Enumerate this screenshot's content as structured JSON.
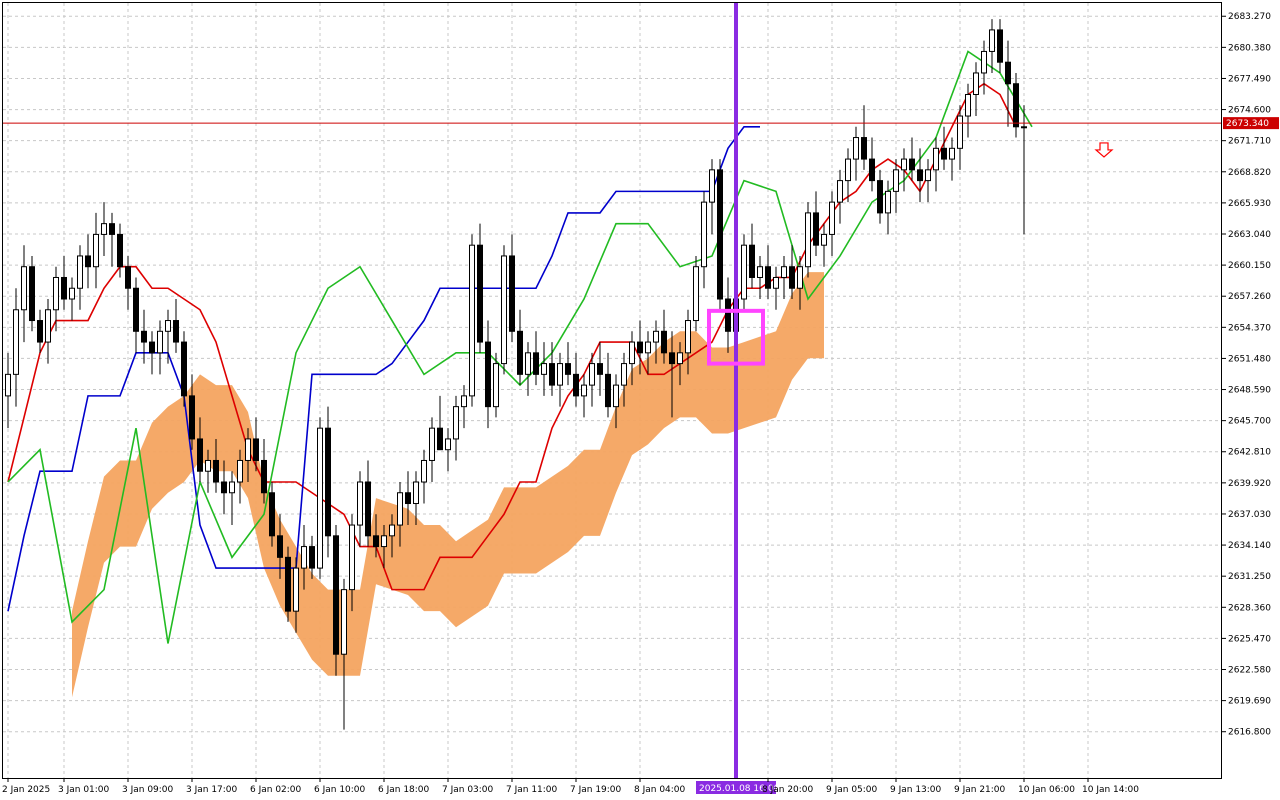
{
  "chart_data": {
    "type": "candlestick",
    "ylim": [
      2612.5,
      2684.5
    ],
    "y_ticks": [
      "2683.270",
      "2680.380",
      "2677.490",
      "2674.600",
      "2671.710",
      "2668.820",
      "2665.930",
      "2663.040",
      "2660.150",
      "2657.260",
      "2654.370",
      "2651.480",
      "2648.590",
      "2645.700",
      "2642.810",
      "2639.920",
      "2637.030",
      "2634.140",
      "2631.250",
      "2628.360",
      "2625.470",
      "2622.580",
      "2619.690",
      "2616.800"
    ],
    "x_ticks": [
      {
        "label": "2 Jan 2025",
        "bar": 0
      },
      {
        "label": "3 Jan 01:00",
        "bar": 7
      },
      {
        "label": "3 Jan 09:00",
        "bar": 15
      },
      {
        "label": "3 Jan 17:00",
        "bar": 23
      },
      {
        "label": "6 Jan 02:00",
        "bar": 31
      },
      {
        "label": "6 Jan 10:00",
        "bar": 39
      },
      {
        "label": "6 Jan 18:00",
        "bar": 47
      },
      {
        "label": "7 Jan 03:00",
        "bar": 55
      },
      {
        "label": "7 Jan 11:00",
        "bar": 63
      },
      {
        "label": "7 Jan 19:00",
        "bar": 71
      },
      {
        "label": "8 Jan 04:00",
        "bar": 79
      },
      {
        "label": "8 Jan 20:00",
        "bar": 95
      },
      {
        "label": "9 Jan 05:00",
        "bar": 103
      },
      {
        "label": "9 Jan 13:00",
        "bar": 111
      },
      {
        "label": "9 Jan 21:00",
        "bar": 119
      },
      {
        "label": "10 Jan 06:00",
        "bar": 127
      },
      {
        "label": "10 Jan 14:00",
        "bar": 135
      }
    ],
    "current_price": {
      "label": "2673.340",
      "value": 2673.34
    },
    "vertical_marker": {
      "label": "2025.01.08 16:00",
      "bar": 91
    },
    "highlight_box": {
      "from_bar": 88,
      "to_bar": 94,
      "y_low": 2651.0,
      "y_high": 2655.9
    },
    "sell_signal": {
      "bar": 137,
      "value": 2671.5
    },
    "candles": [
      [
        2648,
        2652,
        2645,
        2650
      ],
      [
        2650,
        2658,
        2647,
        2656
      ],
      [
        2656,
        2662,
        2653,
        2660
      ],
      [
        2660,
        2661,
        2654,
        2655
      ],
      [
        2655,
        2656,
        2652,
        2653
      ],
      [
        2653,
        2657,
        2651,
        2656
      ],
      [
        2656,
        2660,
        2654,
        2659
      ],
      [
        2659,
        2661,
        2656,
        2657
      ],
      [
        2657,
        2659,
        2655,
        2658
      ],
      [
        2658,
        2662,
        2656,
        2661
      ],
      [
        2661,
        2663,
        2658,
        2660
      ],
      [
        2660,
        2665,
        2658,
        2663
      ],
      [
        2663,
        2666,
        2661,
        2664
      ],
      [
        2664,
        2665,
        2660,
        2663
      ],
      [
        2663,
        2664,
        2659,
        2660
      ],
      [
        2660,
        2661,
        2656,
        2658
      ],
      [
        2658,
        2659,
        2652,
        2654
      ],
      [
        2654,
        2656,
        2651,
        2653
      ],
      [
        2653,
        2654,
        2650,
        2652
      ],
      [
        2652,
        2655,
        2650,
        2654
      ],
      [
        2654,
        2656,
        2651,
        2655
      ],
      [
        2655,
        2657,
        2652,
        2653
      ],
      [
        2653,
        2654,
        2647,
        2648
      ],
      [
        2648,
        2650,
        2643,
        2644
      ],
      [
        2644,
        2646,
        2640,
        2641
      ],
      [
        2641,
        2643,
        2639,
        2642
      ],
      [
        2642,
        2644,
        2639,
        2640
      ],
      [
        2640,
        2642,
        2637,
        2639
      ],
      [
        2639,
        2641,
        2636,
        2640
      ],
      [
        2640,
        2643,
        2638,
        2642
      ],
      [
        2642,
        2645,
        2640,
        2644
      ],
      [
        2644,
        2646,
        2641,
        2642
      ],
      [
        2642,
        2644,
        2638,
        2639
      ],
      [
        2639,
        2640,
        2634,
        2635
      ],
      [
        2635,
        2637,
        2631,
        2633
      ],
      [
        2633,
        2634,
        2627,
        2628
      ],
      [
        2628,
        2633,
        2626,
        2632
      ],
      [
        2632,
        2636,
        2630,
        2634
      ],
      [
        2634,
        2635,
        2631,
        2632
      ],
      [
        2632,
        2646,
        2631,
        2645
      ],
      [
        2645,
        2647,
        2633,
        2635
      ],
      [
        2635,
        2636,
        2622,
        2624
      ],
      [
        2624,
        2631,
        2617,
        2630
      ],
      [
        2630,
        2637,
        2628,
        2636
      ],
      [
        2636,
        2641,
        2634,
        2640
      ],
      [
        2640,
        2642,
        2634,
        2635
      ],
      [
        2635,
        2637,
        2633,
        2634
      ],
      [
        2634,
        2636,
        2632,
        2635
      ],
      [
        2635,
        2637,
        2633,
        2636
      ],
      [
        2636,
        2640,
        2634,
        2639
      ],
      [
        2639,
        2641,
        2636,
        2638
      ],
      [
        2638,
        2641,
        2636,
        2640
      ],
      [
        2640,
        2643,
        2638,
        2642
      ],
      [
        2642,
        2646,
        2640,
        2645
      ],
      [
        2645,
        2648,
        2643,
        2643
      ],
      [
        2643,
        2645,
        2641,
        2644
      ],
      [
        2644,
        2648,
        2642,
        2647
      ],
      [
        2647,
        2649,
        2645,
        2648
      ],
      [
        2648,
        2663,
        2647,
        2662
      ],
      [
        2662,
        2664,
        2652,
        2653
      ],
      [
        2653,
        2655,
        2645,
        2647
      ],
      [
        2647,
        2652,
        2646,
        2651
      ],
      [
        2651,
        2662,
        2650,
        2661
      ],
      [
        2661,
        2663,
        2653,
        2654
      ],
      [
        2654,
        2656,
        2649,
        2650
      ],
      [
        2650,
        2653,
        2648,
        2652
      ],
      [
        2652,
        2654,
        2649,
        2650
      ],
      [
        2650,
        2653,
        2648,
        2651
      ],
      [
        2651,
        2653,
        2648,
        2649
      ],
      [
        2649,
        2652,
        2647,
        2651
      ],
      [
        2651,
        2653,
        2649,
        2650
      ],
      [
        2650,
        2652,
        2647,
        2648
      ],
      [
        2648,
        2650,
        2646,
        2649
      ],
      [
        2649,
        2652,
        2647,
        2651
      ],
      [
        2651,
        2653,
        2648,
        2650
      ],
      [
        2650,
        2652,
        2646,
        2647
      ],
      [
        2647,
        2650,
        2645,
        2649
      ],
      [
        2649,
        2652,
        2647,
        2651
      ],
      [
        2651,
        2654,
        2649,
        2653
      ],
      [
        2653,
        2655,
        2650,
        2652
      ],
      [
        2652,
        2654,
        2650,
        2653
      ],
      [
        2653,
        2655,
        2651,
        2654
      ],
      [
        2654,
        2656,
        2651,
        2652
      ],
      [
        2652,
        2654,
        2646,
        2651
      ],
      [
        2651,
        2653,
        2649,
        2652
      ],
      [
        2652,
        2656,
        2650,
        2655
      ],
      [
        2655,
        2661,
        2654,
        2660
      ],
      [
        2660,
        2667,
        2658,
        2666
      ],
      [
        2666,
        2670,
        2663,
        2669
      ],
      [
        2669,
        2670,
        2656,
        2657
      ],
      [
        2657,
        2659,
        2652,
        2654
      ],
      [
        2654,
        2658,
        2653,
        2657
      ],
      [
        2657,
        2663,
        2656,
        2662
      ],
      [
        2662,
        2664,
        2658,
        2659
      ],
      [
        2659,
        2661,
        2657,
        2660
      ],
      [
        2660,
        2662,
        2657,
        2658
      ],
      [
        2658,
        2660,
        2656,
        2659
      ],
      [
        2659,
        2661,
        2657,
        2660
      ],
      [
        2660,
        2662,
        2657,
        2658
      ],
      [
        2658,
        2661,
        2656,
        2660
      ],
      [
        2660,
        2666,
        2659,
        2665
      ],
      [
        2665,
        2667,
        2661,
        2662
      ],
      [
        2662,
        2664,
        2660,
        2663
      ],
      [
        2663,
        2667,
        2661,
        2666
      ],
      [
        2666,
        2669,
        2664,
        2668
      ],
      [
        2668,
        2671,
        2666,
        2670
      ],
      [
        2670,
        2673,
        2668,
        2672
      ],
      [
        2672,
        2675,
        2669,
        2670
      ],
      [
        2670,
        2672,
        2667,
        2668
      ],
      [
        2668,
        2669,
        2664,
        2665
      ],
      [
        2665,
        2668,
        2663,
        2667
      ],
      [
        2667,
        2670,
        2665,
        2669
      ],
      [
        2669,
        2671,
        2667,
        2670
      ],
      [
        2670,
        2672,
        2668,
        2669
      ],
      [
        2669,
        2671,
        2666,
        2668
      ],
      [
        2668,
        2670,
        2666,
        2669
      ],
      [
        2669,
        2672,
        2667,
        2671
      ],
      [
        2671,
        2673,
        2669,
        2670
      ],
      [
        2670,
        2672,
        2668,
        2671
      ],
      [
        2671,
        2675,
        2669,
        2674
      ],
      [
        2674,
        2677,
        2672,
        2676
      ],
      [
        2676,
        2679,
        2674,
        2678
      ],
      [
        2678,
        2681,
        2676,
        2680
      ],
      [
        2680,
        2683,
        2678,
        2682
      ],
      [
        2682,
        2683,
        2678,
        2679
      ],
      [
        2679,
        2681,
        2673,
        2677
      ],
      [
        2677,
        2678,
        2672,
        2673
      ],
      [
        2673,
        2675,
        2663,
        2673
      ]
    ],
    "series": [
      {
        "name": "",
        "color": "#dd0000",
        "values": [
          2640,
          2646,
          2652,
          2655,
          2655,
          2655,
          2658,
          2660,
          2660,
          2658,
          2658,
          2657,
          2656,
          2653,
          2648,
          2643,
          2640,
          2640,
          2640,
          2639,
          2638,
          2637,
          2634,
          2634,
          2630,
          2630,
          2630,
          2633,
          2633,
          2633,
          2635,
          2637,
          2640,
          2640,
          2645,
          2648,
          2650,
          2653,
          2653,
          2653,
          2650,
          2650,
          2651,
          2652,
          2653,
          2656,
          2658,
          2658,
          2659,
          2659,
          2662,
          2664,
          2666,
          2667,
          2669,
          2670,
          2669,
          2667,
          2670,
          2673,
          2676,
          2677,
          2676,
          2673
        ]
      },
      {
        "name": "",
        "color": "#0000cc",
        "values": [
          2628,
          2635,
          2641,
          2641,
          2641,
          2648,
          2648,
          2648,
          2652,
          2652,
          2652,
          2648,
          2636,
          2632,
          2632,
          2632,
          2632,
          2632,
          2632,
          2650,
          2650,
          2650,
          2650,
          2650,
          2651,
          2653,
          2655,
          2658,
          2658,
          2658,
          2658,
          2658,
          2658,
          2658,
          2661,
          2665,
          2665,
          2665,
          2667,
          2667,
          2667,
          2667,
          2667,
          2667,
          2667,
          2671,
          2673,
          2673
        ]
      },
      {
        "name": "",
        "color": "#22bb22",
        "values": [
          2640,
          2643,
          2627,
          2630,
          2645,
          2625,
          2640,
          2633,
          2637,
          2652,
          2658,
          2660,
          2655,
          2650,
          2652,
          2652,
          2649,
          2652,
          2657,
          2664,
          2664,
          2660,
          2661,
          2668,
          2667,
          2657,
          2661,
          2666,
          2668,
          2672,
          2680,
          2678,
          2673
        ]
      }
    ]
  }
}
